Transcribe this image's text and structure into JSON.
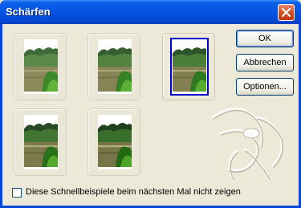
{
  "window": {
    "title": "Schärfen"
  },
  "buttons": {
    "ok": "OK",
    "cancel": "Abbrechen",
    "options": "Optionen..."
  },
  "thumbnails": {
    "count": 5,
    "selected_index": 3
  },
  "checkbox": {
    "label": "Diese Schnellbeispiele beim nächsten Mal nicht zeigen",
    "checked": false
  },
  "colors": {
    "titlebar": "#0554e3",
    "selection": "#0000c8",
    "background": "#ece9d8"
  }
}
